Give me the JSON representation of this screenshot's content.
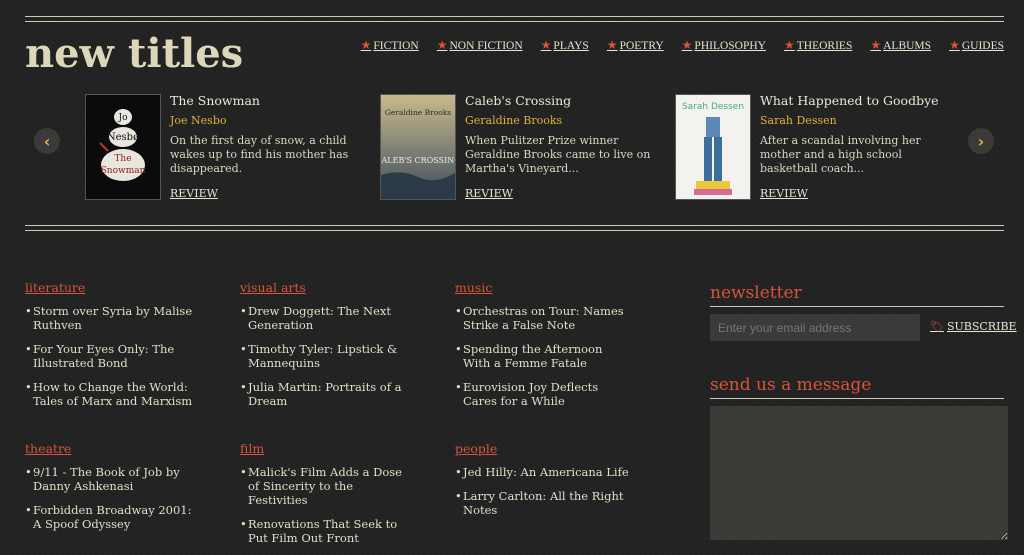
{
  "brand": {
    "title": "new titles"
  },
  "nav": [
    {
      "label": "FICTION"
    },
    {
      "label": "NON FICTION"
    },
    {
      "label": "PLAYS"
    },
    {
      "label": "POETRY"
    },
    {
      "label": "PHILOSOPHY"
    },
    {
      "label": "THEORIES"
    },
    {
      "label": "ALBUMS"
    },
    {
      "label": "GUIDES"
    }
  ],
  "carousel": {
    "prev_icon": "chevron-left-icon",
    "next_icon": "chevron-right-icon",
    "books": [
      {
        "title": "The Snowman",
        "author": "Joe Nesbo",
        "desc": "On the first day of snow, a child wakes up to find his mother has disappeared.",
        "review": "REVIEW",
        "cover_text": [
          "Jo",
          "Nesbø",
          "The",
          "Snowman"
        ]
      },
      {
        "title": "Caleb's Crossing",
        "author": "Geraldine Brooks",
        "desc": "When Pulitzer Prize winner Geraldine Brooks came to live on Martha's Vineyard...",
        "review": "REVIEW",
        "cover_text": [
          "Geraldine Brooks",
          "CALEB'S CROSSING"
        ]
      },
      {
        "title": "What Happened to Goodbye",
        "author": "Sarah Dessen",
        "desc": "After a scandal involving her mother and a high school basketball coach...",
        "review": "REVIEW",
        "cover_text": [
          "Sarah Dessen"
        ]
      }
    ]
  },
  "categories": [
    {
      "name": "literature",
      "items": [
        "Storm over Syria by Malise Ruthven",
        "For Your Eyes Only: The Illustrated Bond",
        "How to Change the World: Tales of Marx and Marxism"
      ]
    },
    {
      "name": "visual arts",
      "items": [
        "Drew Doggett: The Next Generation",
        "Timothy Tyler: Lipstick & Mannequins",
        "Julia Martin: Portraits of a Dream"
      ]
    },
    {
      "name": "music",
      "items": [
        "Orchestras on Tour: Names Strike a False Note",
        "Spending the Afternoon With a Femme Fatale",
        "Eurovision Joy Deflects Cares for a While"
      ]
    },
    {
      "name": "theatre",
      "items": [
        "9/11 - The Book of Job by Danny Ashkenasi",
        "Forbidden Broadway 2001: A Spoof Odyssey"
      ]
    },
    {
      "name": "film",
      "items": [
        "Malick's Film Adds a Dose of Sincerity to the Festivities",
        "Renovations That Seek to Put Film Out Front"
      ]
    },
    {
      "name": "people",
      "items": [
        "Jed Hilly: An Americana Life",
        "Larry Carlton: All the Right Notes"
      ]
    }
  ],
  "newsletter": {
    "heading": "newsletter",
    "placeholder": "Enter your email address",
    "subscribe": "SUBSCRIBE"
  },
  "message": {
    "heading": "send us a message"
  },
  "colors": {
    "accent": "#d9533a",
    "gold": "#e2b23a",
    "background": "#222222",
    "panel": "#3a3a38"
  }
}
